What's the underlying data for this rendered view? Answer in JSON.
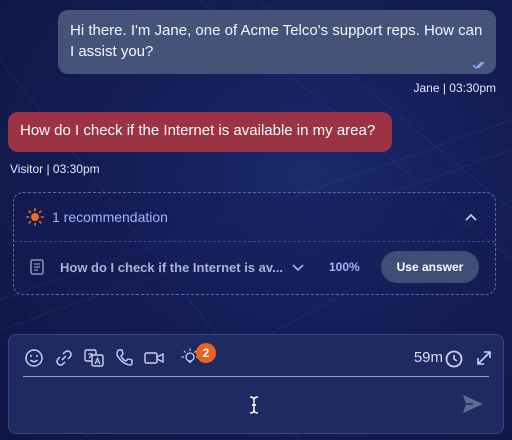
{
  "agent_message": {
    "text": "Hi there. I'm Jane, one of Acme Telco's support reps. How can I assist you?",
    "meta": "Jane | 03:30pm"
  },
  "visitor_message": {
    "text": "How do I check if the Internet is available in my area?",
    "meta": "Visitor | 03:30pm"
  },
  "recommendations": {
    "header": "1 recommendation",
    "items": [
      {
        "question": "How do I check if the Internet is av...",
        "score": "100%",
        "button": "Use answer"
      }
    ]
  },
  "composer": {
    "badge_count": "2",
    "timer": "59m",
    "placeholder": ""
  },
  "colors": {
    "agent_bubble": "#465378",
    "visitor_bubble": "#9b3344",
    "badge": "#e8651f",
    "accent_sun": "#f26b21"
  },
  "icons": [
    "read-check-icon",
    "sun-icon",
    "chevron-up-icon",
    "document-icon",
    "chevron-down-icon",
    "emoji-icon",
    "link-icon",
    "translate-icon",
    "phone-icon",
    "video-icon",
    "bulb-icon",
    "clock-icon",
    "expand-icon",
    "text-cursor-icon",
    "send-icon"
  ]
}
